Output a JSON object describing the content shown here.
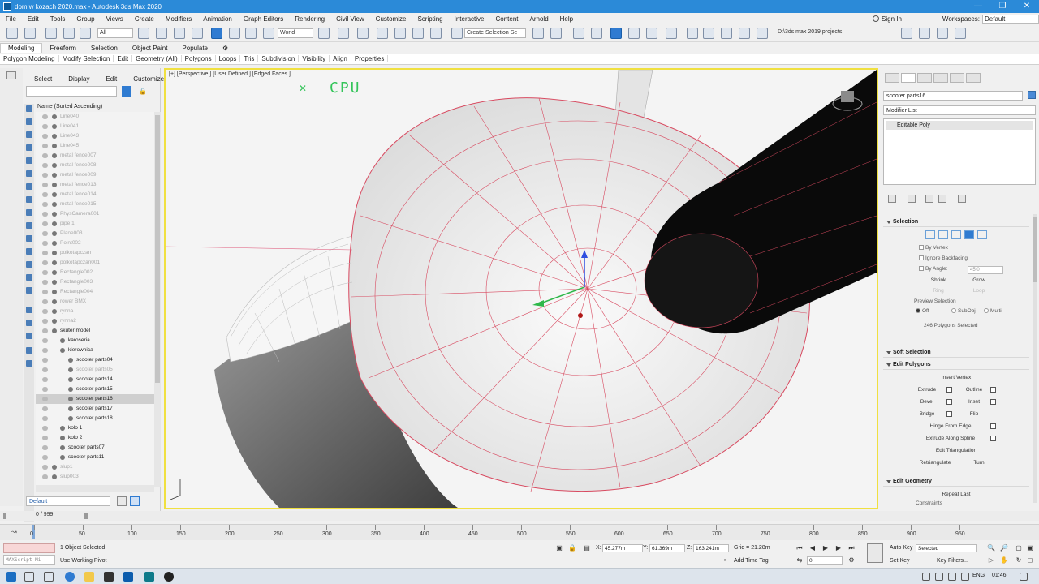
{
  "window": {
    "title": "dom w kozach 2020.max - Autodesk 3ds Max 2020",
    "minimize": "—",
    "maximize": "❐",
    "close": "✕"
  },
  "menu": {
    "items": [
      "File",
      "Edit",
      "Tools",
      "Group",
      "Views",
      "Create",
      "Modifiers",
      "Animation",
      "Graph Editors",
      "Rendering",
      "Civil View",
      "Customize",
      "Scripting",
      "Interactive",
      "Content",
      "Arnold",
      "Help"
    ],
    "sign_in": "Sign In",
    "workspaces_label": "Workspaces:",
    "workspace_value": "Default"
  },
  "toolbar": {
    "filter_value": "All",
    "coord_system": "World",
    "selection_set_placeholder": "Create Selection Se",
    "project_path": "D:\\3ds max 2019 projects"
  },
  "ribbon": {
    "tabs": [
      "Modeling",
      "Freeform",
      "Selection",
      "Object Paint",
      "Populate"
    ],
    "active_tab": "Modeling",
    "sub_items": [
      "Polygon Modeling",
      "Modify Selection",
      "Edit",
      "Geometry (All)",
      "Polygons",
      "Loops",
      "Tris",
      "Subdivision",
      "Visibility",
      "Align",
      "Properties"
    ]
  },
  "explorer": {
    "tabs": [
      "Select",
      "Display",
      "Edit",
      "Customize"
    ],
    "header": "Name (Sorted Ascending)",
    "rows": [
      {
        "label": "Line040",
        "indent": 0,
        "dim": true
      },
      {
        "label": "Line041",
        "indent": 0,
        "dim": true
      },
      {
        "label": "Line043",
        "indent": 0,
        "dim": true
      },
      {
        "label": "Line045",
        "indent": 0,
        "dim": true
      },
      {
        "label": "metal fence007",
        "indent": 0,
        "dim": true
      },
      {
        "label": "metal fence008",
        "indent": 0,
        "dim": true
      },
      {
        "label": "metal fence009",
        "indent": 0,
        "dim": true
      },
      {
        "label": "metal fence013",
        "indent": 0,
        "dim": true
      },
      {
        "label": "metal fence014",
        "indent": 0,
        "dim": true
      },
      {
        "label": "metal fence015",
        "indent": 0,
        "dim": true
      },
      {
        "label": "PhysCamera001",
        "indent": 0,
        "dim": true
      },
      {
        "label": "pipe 1",
        "indent": 0,
        "dim": true
      },
      {
        "label": "Plane003",
        "indent": 0,
        "dim": true
      },
      {
        "label": "Point002",
        "indent": 0,
        "dim": true
      },
      {
        "label": "polkotapczan",
        "indent": 0,
        "dim": true
      },
      {
        "label": "polkotapczan001",
        "indent": 0,
        "dim": true
      },
      {
        "label": "Rectangle002",
        "indent": 0,
        "dim": true
      },
      {
        "label": "Rectangle003",
        "indent": 0,
        "dim": true
      },
      {
        "label": "Rectangle004",
        "indent": 0,
        "dim": true
      },
      {
        "label": "rower BMX",
        "indent": 0,
        "dim": true
      },
      {
        "label": "rynna",
        "indent": 0,
        "dim": true
      },
      {
        "label": "rynna2",
        "indent": 0,
        "dim": true
      },
      {
        "label": "skuter model",
        "indent": 0,
        "dim": false
      },
      {
        "label": "karoseria",
        "indent": 1,
        "dim": false
      },
      {
        "label": "kierownica",
        "indent": 1,
        "dim": false
      },
      {
        "label": "scooter parts04",
        "indent": 2,
        "dim": false
      },
      {
        "label": "scooter parts05",
        "indent": 2,
        "dim": true
      },
      {
        "label": "scooter parts14",
        "indent": 2,
        "dim": false
      },
      {
        "label": "scooter parts15",
        "indent": 2,
        "dim": false
      },
      {
        "label": "scooter parts16",
        "indent": 2,
        "dim": false,
        "selected": true
      },
      {
        "label": "scooter parts17",
        "indent": 2,
        "dim": false
      },
      {
        "label": "scooter parts18",
        "indent": 2,
        "dim": false
      },
      {
        "label": "kolo 1",
        "indent": 1,
        "dim": false
      },
      {
        "label": "kolo 2",
        "indent": 1,
        "dim": false
      },
      {
        "label": "scooter parts07",
        "indent": 1,
        "dim": false
      },
      {
        "label": "scooter parts11",
        "indent": 1,
        "dim": false
      },
      {
        "label": "slup1",
        "indent": 0,
        "dim": true
      },
      {
        "label": "slup003",
        "indent": 0,
        "dim": true
      }
    ],
    "layer": "Default"
  },
  "viewport": {
    "label": "[+] [Perspective ] [User Defined ] [Edged Faces ]",
    "overlay_text": "CPU",
    "overlay_mark": "✕"
  },
  "command_panel": {
    "object_name": "scooter parts16",
    "modifier_list": "Modifier List",
    "stack_item": "Editable Poly",
    "selection": {
      "title": "Selection",
      "by_vertex": "By Vertex",
      "ignore_backfacing": "Ignore Backfacing",
      "by_angle": "By Angle:",
      "angle_value": "45.0",
      "shrink": "Shrink",
      "grow": "Grow",
      "ring": "Ring",
      "loop": "Loop",
      "preview_selection": "Preview Selection",
      "preview_options": [
        "Off",
        "SubObj",
        "Multi"
      ],
      "status": "246 Polygons Selected"
    },
    "soft_selection": "Soft Selection",
    "edit_polygons": {
      "title": "Edit Polygons",
      "insert_vertex": "Insert Vertex",
      "extrude": "Extrude",
      "outline": "Outline",
      "bevel": "Bevel",
      "inset": "Inset",
      "bridge": "Bridge",
      "flip": "Flip",
      "hinge": "Hinge From Edge",
      "extrude_spline": "Extrude Along Spline",
      "edit_triangulation": "Edit Triangulation",
      "retriangulate": "Retriangulate",
      "turn": "Turn"
    },
    "edit_geometry": {
      "title": "Edit Geometry",
      "repeat_last": "Repeat Last",
      "constraints": "Constraints"
    }
  },
  "timeline": {
    "frame": "0 / 999",
    "ticks": [
      "0",
      "50",
      "100",
      "150",
      "200",
      "250",
      "300",
      "350",
      "400",
      "450",
      "500",
      "550",
      "600",
      "650",
      "700",
      "750",
      "800",
      "850",
      "900",
      "950"
    ]
  },
  "status": {
    "maxscript": "MAXScript Mi",
    "selected": "1 Object Selected",
    "pivot": "Use Working Pivot",
    "x": "45.277m",
    "y": "61.369m",
    "z": "163.241m",
    "grid": "Grid = 21.28m",
    "add_time_tag": "Add Time Tag",
    "frame_value": "0",
    "auto_key": "Auto Key",
    "set_key": "Set Key",
    "key_mode": "Selected",
    "key_filters": "Key Filters..."
  },
  "taskbar": {
    "lang": "ENG",
    "time": "01:46"
  }
}
